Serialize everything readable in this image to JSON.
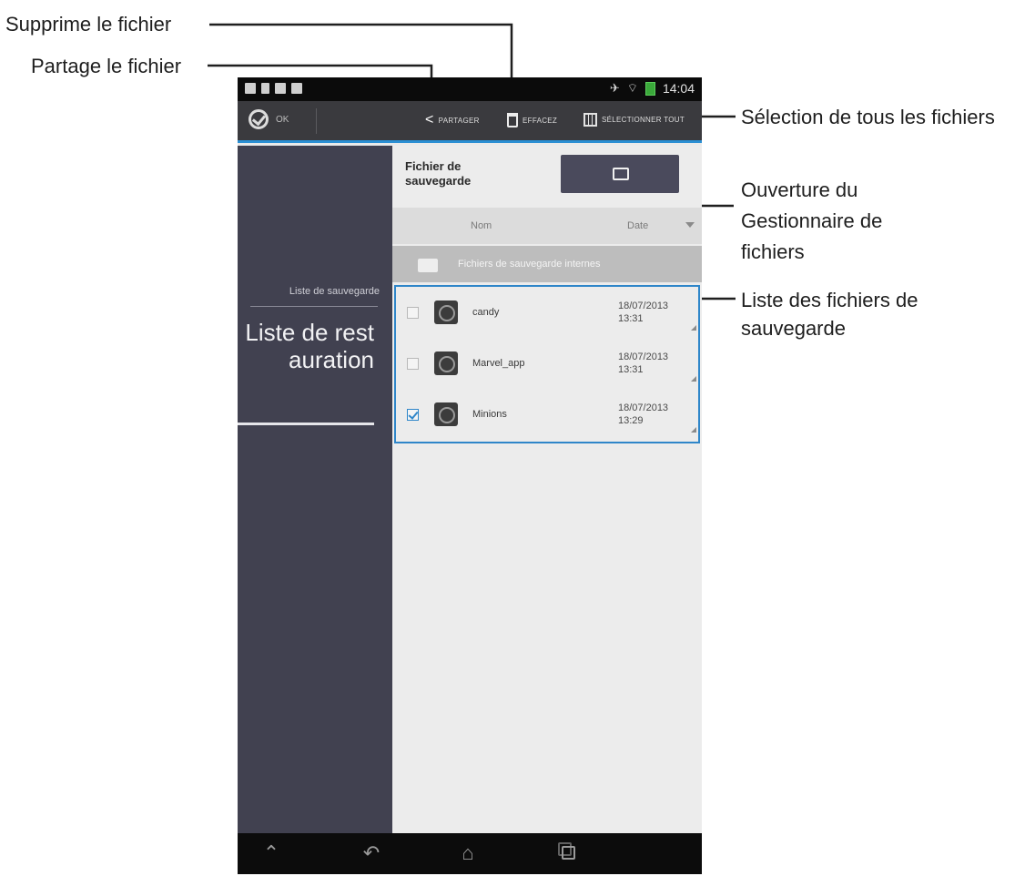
{
  "callouts": {
    "delete": "Supprime le fichier",
    "share": "Partage le fichier",
    "select_all": "Sélection de tous les fichiers",
    "open_manager": "Ouverture du Gestionnaire de fichiers",
    "backup_list": "Liste des fichiers de sauvegarde"
  },
  "status_bar": {
    "time": "14:04",
    "icons": [
      "screenshot-icon",
      "document-icon",
      "sd-card-icon",
      "download-icon",
      "airplane-mode-icon",
      "wifi-icon",
      "battery-icon"
    ]
  },
  "action_bar": {
    "ok_label": "OK",
    "share_label": "PARTAGER",
    "delete_label": "EFFACEZ",
    "select_all_label": "SÉLECTIONNER TOUT"
  },
  "sidebar": {
    "tab_backup": "Liste de sauvegarde",
    "tab_restore": "Liste de restauration"
  },
  "content": {
    "backup_file_label": "Fichier de sauvegarde",
    "columns": {
      "name": "Nom",
      "date": "Date"
    },
    "group_label": "Fichiers de sauvegarde internes",
    "files": [
      {
        "name": "candy",
        "date": "18/07/2013",
        "time": "13:31",
        "checked": false
      },
      {
        "name": "Marvel_app",
        "date": "18/07/2013",
        "time": "13:31",
        "checked": false
      },
      {
        "name": "Minions",
        "date": "18/07/2013",
        "time": "13:29",
        "checked": true
      }
    ]
  },
  "colors": {
    "accent": "#2b8fd3",
    "sidebar_bg": "#414150",
    "action_bar_bg": "#3a3a3e",
    "folder_button_bg": "#4a4a5c"
  }
}
